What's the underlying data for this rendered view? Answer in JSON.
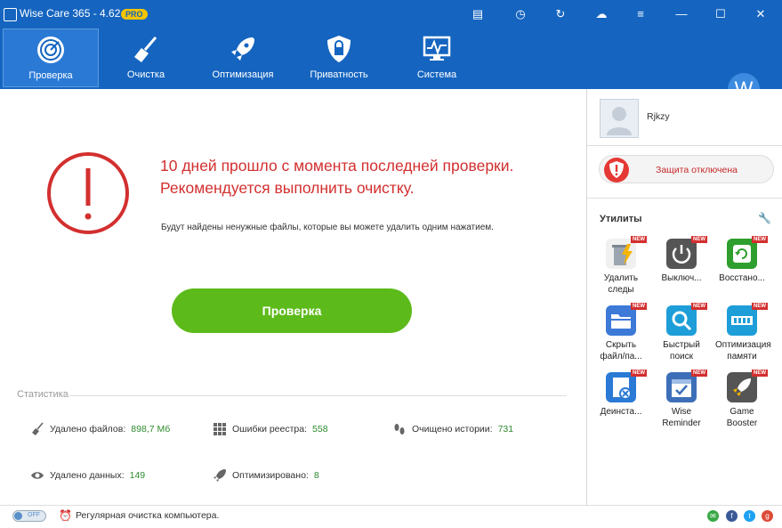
{
  "window": {
    "title": "Wise Care 365 - 4.62",
    "badge": "PRO",
    "controls": [
      "feedback-icon",
      "restore-icon",
      "refresh-icon",
      "upload-icon",
      "menu-icon",
      "minimize-icon",
      "maximize-icon",
      "close-icon"
    ]
  },
  "nav": {
    "items": [
      {
        "label": "Проверка",
        "icon": "radar-icon",
        "active": true
      },
      {
        "label": "Очистка",
        "icon": "broom-icon",
        "active": false
      },
      {
        "label": "Оптимизация",
        "icon": "rocket-icon",
        "active": false
      },
      {
        "label": "Приватность",
        "icon": "shield-lock-icon",
        "active": false
      },
      {
        "label": "Система",
        "icon": "monitor-icon",
        "active": false
      }
    ],
    "account_letter": "W"
  },
  "main": {
    "headline": "10 дней прошло с момента последней проверки. Рекомендуется выполнить очистку.",
    "subtext": "Будут найдены ненужные файлы, которые вы можете удалить одним нажатием.",
    "scan_button": "Проверка",
    "stats_label": "Статистика",
    "stats": [
      {
        "label": "Удалено файлов:",
        "value": "898,7 Мб",
        "icon": "broom-icon"
      },
      {
        "label": "Ошибки реестра:",
        "value": "558",
        "icon": "grid-icon"
      },
      {
        "label": "Очищено истории:",
        "value": "731",
        "icon": "footprints-icon"
      },
      {
        "label": "Удалено данных:",
        "value": "149",
        "icon": "eye-icon"
      },
      {
        "label": "Оптимизировано:",
        "value": "8",
        "icon": "rocket-icon"
      }
    ]
  },
  "sidebar": {
    "username": "Rjkzy",
    "protection": "Защита отключена",
    "utilities_title": "Утилиты",
    "new_badge": "NEW",
    "utilities": [
      {
        "label": "Удалить\nследы",
        "icon": "trash-bolt-icon",
        "color": "#e8a020"
      },
      {
        "label": "Выключ...",
        "icon": "power-icon",
        "color": "#555555"
      },
      {
        "label": "Восстано...",
        "icon": "restore-icon",
        "color": "#2e9e2e"
      },
      {
        "label": "Скрыть\nфайл/па...",
        "icon": "folder-icon",
        "color": "#3d7ad8"
      },
      {
        "label": "Быстрый\nпоиск",
        "icon": "search-icon",
        "color": "#1e9ed8"
      },
      {
        "label": "Оптимизация\nпамяти",
        "icon": "memory-icon",
        "color": "#1e9ed8"
      },
      {
        "label": "Деинста...",
        "icon": "uninstall-icon",
        "color": "#2a7ad5"
      },
      {
        "label": "Wise\nReminder",
        "icon": "calendar-check-icon",
        "color": "#3d6fb8"
      },
      {
        "label": "Game\nBooster",
        "icon": "rocket-icon",
        "color": "#555555"
      }
    ]
  },
  "footer": {
    "toggle_label": "OFF",
    "text": "Регулярная очистка компьютера.",
    "social": [
      {
        "icon": "message-icon",
        "color": "#3aa845",
        "glyph": "✉"
      },
      {
        "icon": "facebook-icon",
        "color": "#3b5998",
        "glyph": "f"
      },
      {
        "icon": "twitter-icon",
        "color": "#1da1f2",
        "glyph": "t"
      },
      {
        "icon": "google-plus-icon",
        "color": "#dd4b39",
        "glyph": "g"
      }
    ]
  },
  "colors": {
    "header": "#1565c0",
    "alert": "#d32f2f",
    "scan_button": "#5cbb1a",
    "stat_value": "#2e8b2e"
  }
}
